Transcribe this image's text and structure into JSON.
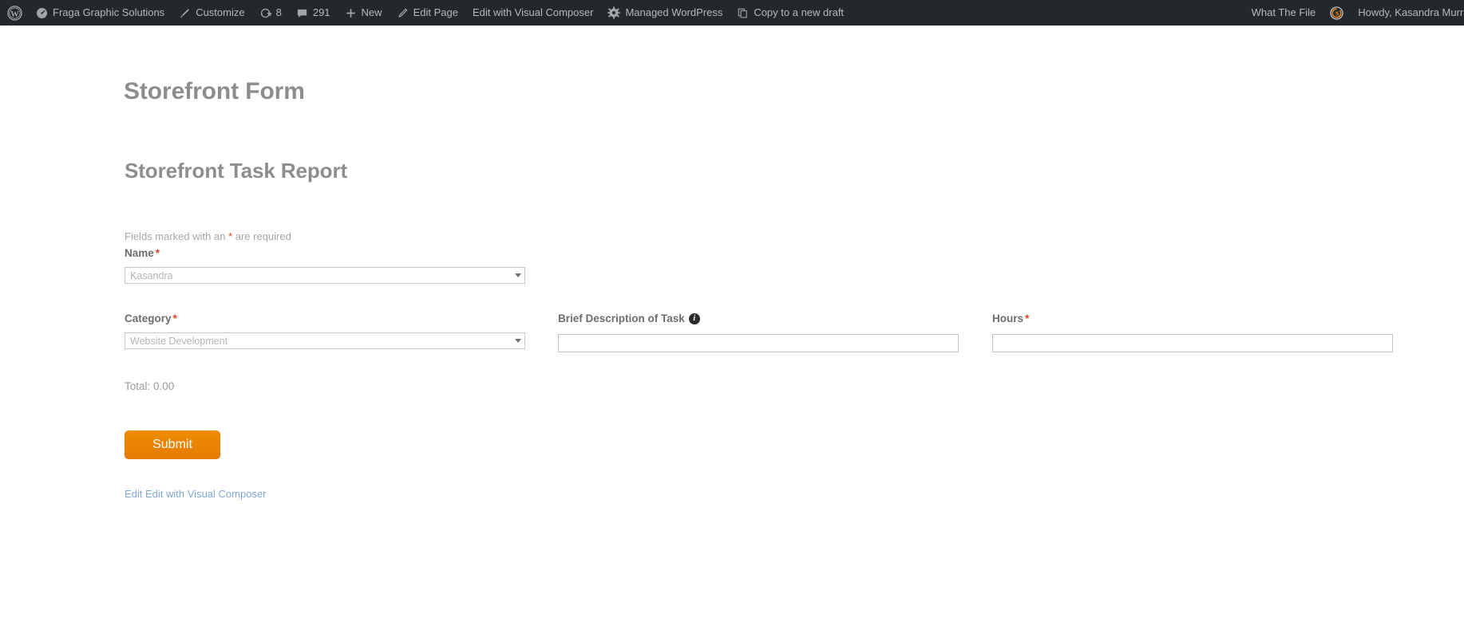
{
  "admin_bar": {
    "background": "#23282d",
    "text_color": "#b4b9be",
    "left_items": [
      {
        "name": "wp-logo",
        "icon": "wordpress-icon",
        "label": ""
      },
      {
        "name": "site-name",
        "icon": "dashboard-icon",
        "label": "Fraga Graphic Solutions"
      },
      {
        "name": "customize",
        "icon": "paintbrush-icon",
        "label": "Customize"
      },
      {
        "name": "updates",
        "icon": "update-arrows-icon",
        "label": "8"
      },
      {
        "name": "comments",
        "icon": "comment-bubble-icon",
        "label": "291"
      },
      {
        "name": "new-content",
        "icon": "plus-icon",
        "label": "New"
      },
      {
        "name": "edit-page",
        "icon": "pencil-icon",
        "label": "Edit Page"
      },
      {
        "name": "edit-with-visual-composer",
        "icon": "",
        "label": "Edit with Visual Composer"
      },
      {
        "name": "managed-wordpress",
        "icon": "gear-icon",
        "label": "Managed WordPress"
      },
      {
        "name": "copy-to-new-draft",
        "icon": "copy-icon",
        "label": "Copy to a new draft"
      }
    ],
    "right_items": [
      {
        "name": "what-the-file",
        "icon": "",
        "label": "What The File"
      },
      {
        "name": "ninja-forms-logo",
        "icon": "ninja-forms-icon",
        "label": ""
      },
      {
        "name": "my-account",
        "icon": "",
        "label": "Howdy, Kasandra Murray"
      }
    ]
  },
  "page": {
    "title": "Storefront Form",
    "form_heading": "Storefront Task Report",
    "required_note_prefix": "Fields marked with an ",
    "required_marker": "*",
    "required_note_suffix": " are required"
  },
  "form": {
    "name_field": {
      "label": "Name",
      "required_marker": "*",
      "selected_value": "Kasandra",
      "control": "select"
    },
    "category_field": {
      "label": "Category",
      "required_marker": "*",
      "selected_value": "Website Development",
      "control": "select"
    },
    "description_field": {
      "label": "Brief Description of Task",
      "required_marker": "",
      "value": "",
      "placeholder": "",
      "help_icon": "info-icon",
      "control": "text"
    },
    "hours_field": {
      "label": "Hours",
      "required_marker": "*",
      "value": "",
      "placeholder": "",
      "control": "text"
    },
    "total_text": "Total: 0.00",
    "submit_label": "Submit",
    "submit_color": "#ec8000"
  },
  "footer_links": {
    "edit_line": "Edit Edit with Visual Composer",
    "link_color": "#7fa8d4"
  }
}
